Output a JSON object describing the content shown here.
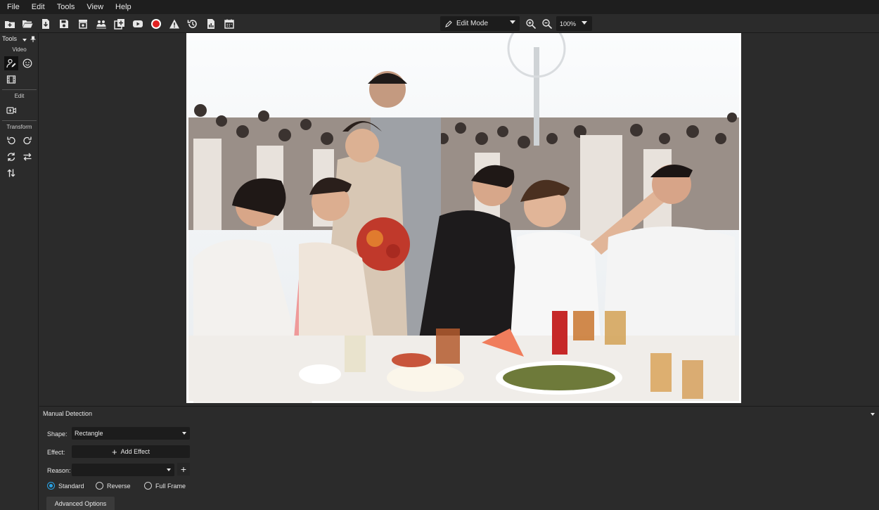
{
  "menu": [
    "File",
    "Edit",
    "Tools",
    "View",
    "Help"
  ],
  "toolbar": {
    "icons": [
      "new-project-icon",
      "open-folder-icon",
      "import-file-icon",
      "save-icon",
      "archive-icon",
      "people-detect-icon",
      "add-clip-icon",
      "youtube-icon",
      "record-icon",
      "warning-icon",
      "history-icon",
      "report-icon",
      "calendar-icon"
    ],
    "mode_label": "Edit Mode",
    "zoom_label": "100%"
  },
  "tools_panel": {
    "title": "Tools",
    "sections": {
      "video": "Video",
      "edit": "Edit",
      "transform": "Transform"
    }
  },
  "canvas": {
    "image_alt": "Wedding reception group photo"
  },
  "detection_panel": {
    "title": "Manual Detection",
    "shape_label": "Shape:",
    "shape_value": "Rectangle",
    "effect_label": "Effect:",
    "add_effect_label": "Add Effect",
    "reason_label": "Reason:",
    "reason_value": "",
    "radio_options": [
      {
        "label": "Standard",
        "checked": true
      },
      {
        "label": "Reverse",
        "checked": false
      },
      {
        "label": "Full Frame",
        "checked": false
      }
    ],
    "advanced_label": "Advanced Options"
  },
  "colors": {
    "accent": "#29a3e6",
    "record_red": "#e02020",
    "background": "#2b2b2b",
    "menubar": "#1e1e1e"
  }
}
